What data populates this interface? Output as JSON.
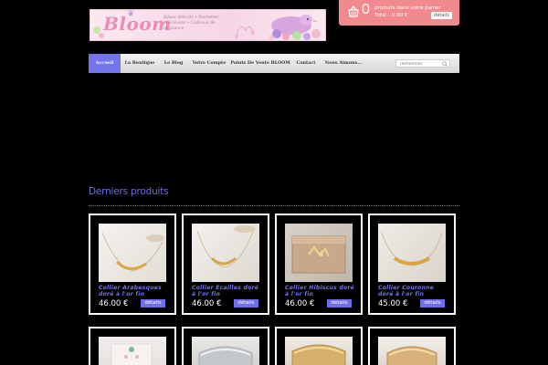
{
  "header": {
    "logo_text": "Bloom",
    "logo_tagline": "Bijoux délicats • Pochettes précieuses • Cadeaux de naissance",
    "cart": {
      "count": "0",
      "label": "produits dans votre panier",
      "total_label": "Total :",
      "total_value": "0.00 €",
      "button_label": "détails",
      "accent_color": "#f08a8f"
    }
  },
  "nav": {
    "items": [
      {
        "label": "Accueil"
      },
      {
        "label": "La Boutique"
      },
      {
        "label": "Le Blog"
      },
      {
        "label": "Votre Compte"
      },
      {
        "label": "Points De Vente BLOOM"
      },
      {
        "label": "Contact"
      },
      {
        "label": "Nous Aimons..."
      }
    ],
    "active_color": "#7474ee",
    "search_placeholder": "rechercher"
  },
  "main": {
    "section_title": "Derniers produits",
    "products": [
      {
        "title": "Collier Arabesques doré à l'or fin",
        "price": "46.00 €",
        "button": "détails"
      },
      {
        "title": "Collier Ecailles doré à l'or fin",
        "price": "46.00 €",
        "button": "détails"
      },
      {
        "title": "Collier Hibiscus doré à l'or fin",
        "price": "46.00 €",
        "button": "détails"
      },
      {
        "title": "Collier Couronne doré à l'or fin",
        "price": "45.00 €",
        "button": "détails"
      }
    ]
  }
}
